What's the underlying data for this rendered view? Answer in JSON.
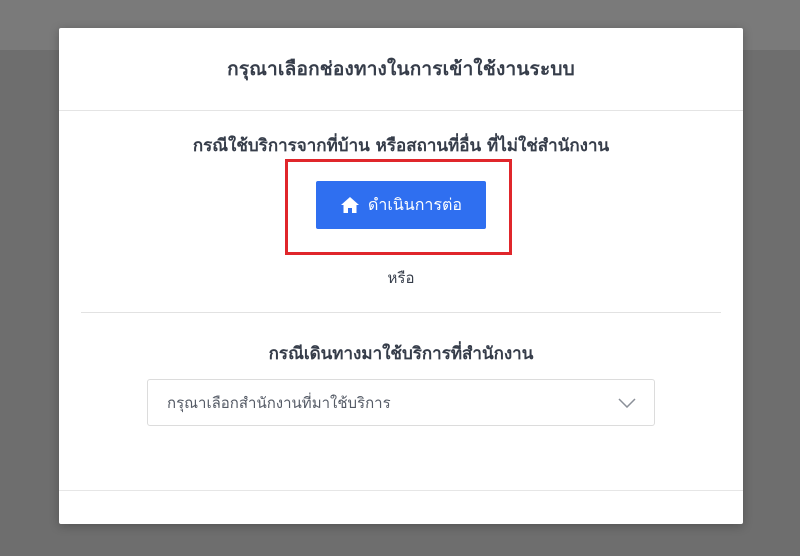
{
  "modal": {
    "title": "กรุณาเลือกช่องทางในการเข้าใช้งานระบบ"
  },
  "home_section": {
    "heading": "กรณีใช้บริการจากที่บ้าน หรือสถานที่อื่น ที่ไม่ใช่สำนักงาน",
    "continue_button": {
      "label": "ดำเนินการต่อ",
      "icon": "home-icon"
    },
    "highlight_color": "#e0262b"
  },
  "separator": {
    "or_label": "หรือ"
  },
  "office_section": {
    "heading": "กรณีเดินทางมาใช้บริการที่สำนักงาน",
    "select": {
      "placeholder": "กรุณาเลือกสำนักงานที่มาใช้บริการ",
      "icon": "chevron-down-icon"
    }
  },
  "colors": {
    "primary_button": "#2f6ff0",
    "text": "#363d4a",
    "overlay": "#6e6e6e"
  }
}
